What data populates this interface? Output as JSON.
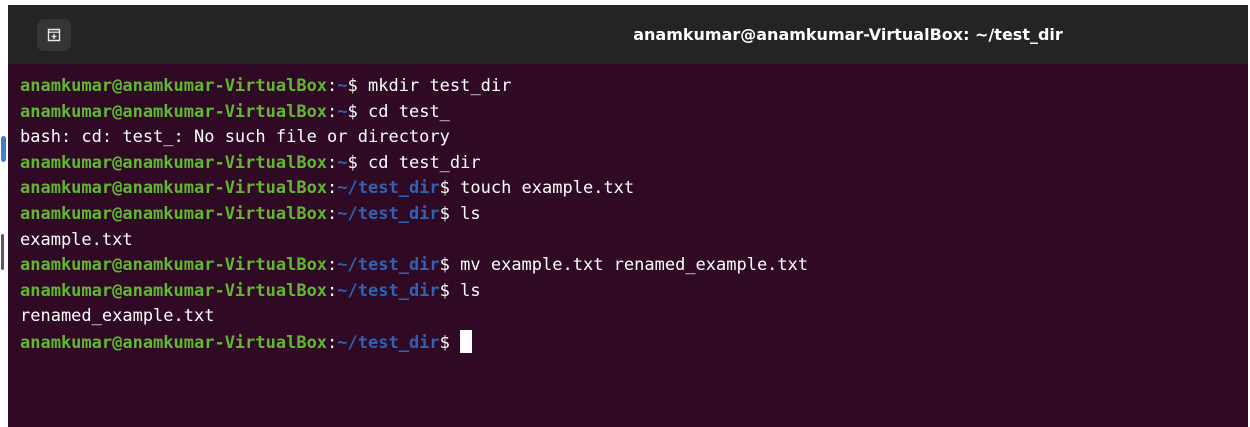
{
  "window": {
    "title": "anamkumar@anamkumar-VirtualBox: ~/test_dir",
    "new_tab_icon": "new-tab-icon"
  },
  "terminal": {
    "lines": [
      {
        "type": "prompt",
        "user_host": "anamkumar@anamkumar-VirtualBox",
        "sep": ":",
        "path": "~",
        "sigil": "$ ",
        "command": "mkdir test_dir"
      },
      {
        "type": "prompt",
        "user_host": "anamkumar@anamkumar-VirtualBox",
        "sep": ":",
        "path": "~",
        "sigil": "$ ",
        "command": "cd test_"
      },
      {
        "type": "output",
        "text": "bash: cd: test_: No such file or directory"
      },
      {
        "type": "prompt",
        "user_host": "anamkumar@anamkumar-VirtualBox",
        "sep": ":",
        "path": "~",
        "sigil": "$ ",
        "command": "cd test_dir"
      },
      {
        "type": "prompt",
        "user_host": "anamkumar@anamkumar-VirtualBox",
        "sep": ":",
        "path": "~/test_dir",
        "sigil": "$ ",
        "command": "touch example.txt"
      },
      {
        "type": "prompt",
        "user_host": "anamkumar@anamkumar-VirtualBox",
        "sep": ":",
        "path": "~/test_dir",
        "sigil": "$ ",
        "command": "ls"
      },
      {
        "type": "output",
        "text": "example.txt"
      },
      {
        "type": "prompt",
        "user_host": "anamkumar@anamkumar-VirtualBox",
        "sep": ":",
        "path": "~/test_dir",
        "sigil": "$ ",
        "command": "mv example.txt renamed_example.txt"
      },
      {
        "type": "prompt",
        "user_host": "anamkumar@anamkumar-VirtualBox",
        "sep": ":",
        "path": "~/test_dir",
        "sigil": "$ ",
        "command": "ls"
      },
      {
        "type": "output",
        "text": "renamed_example.txt"
      },
      {
        "type": "prompt",
        "user_host": "anamkumar@anamkumar-VirtualBox",
        "sep": ":",
        "path": "~/test_dir",
        "sigil": "$ ",
        "command": "",
        "cursor": true
      }
    ]
  },
  "colors": {
    "background": "#300a24",
    "titlebar": "#242424",
    "user_host": "#61b830",
    "path": "#2e62b3",
    "text": "#ffffff"
  }
}
